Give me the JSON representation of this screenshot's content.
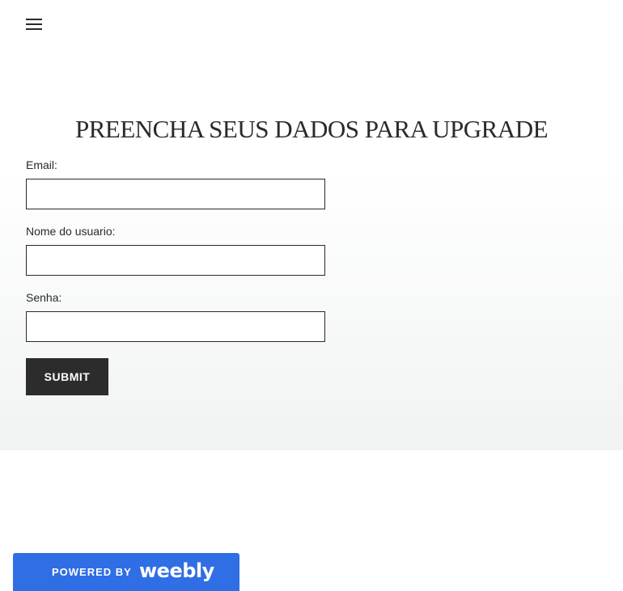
{
  "header": {
    "menu_icon": "hamburger-menu-icon"
  },
  "form": {
    "title": "PREENCHA SEUS DADOS PARA UPGRADE",
    "email_label": "Email:",
    "email_value": "",
    "username_label": "Nome do usuario:",
    "username_value": "",
    "password_label": "Senha:",
    "password_value": "",
    "submit_label": "SUBMIT"
  },
  "footer": {
    "powered_by": "POWERED BY",
    "brand": "weebly",
    "accent_color": "#2f6ee5"
  }
}
